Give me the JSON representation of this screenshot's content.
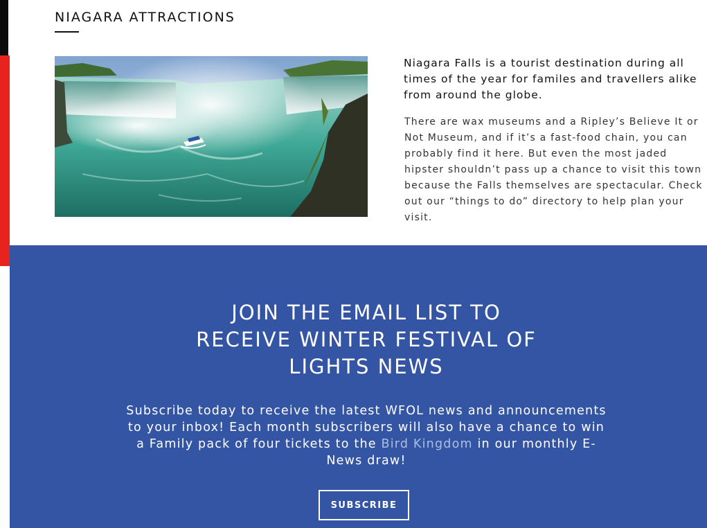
{
  "attractions": {
    "title": "NIAGARA ATTRACTIONS",
    "image_subject": "horseshoe-falls-with-tour-boat-photo",
    "intro": [
      "Niagara Falls is a tourist destination during all",
      "times of the year for familes and travellers alike",
      "from around the globe."
    ],
    "body": [
      "There are wax museums and a Ripley’s Believe It or",
      "Not Museum, and if it’s a fast-food chain, you can",
      "probably find it here. But even the most jaded",
      "hipster shouldn’t pass up a chance to visit this town",
      "because the Falls themselves are spectacular. Check",
      "out our “things to do” directory to help plan your",
      "visit."
    ]
  },
  "signup": {
    "heading": [
      "JOIN THE EMAIL LIST TO",
      "RECEIVE WINTER FESTIVAL OF",
      "LIGHTS NEWS"
    ],
    "body": {
      "line1": "Subscribe today to receive the latest WFOL news and announcements",
      "line2": "to your inbox! Each month subscribers will also have a chance to win",
      "line3_before": "a Family pack of four tickets to the ",
      "link_text": "Bird Kingdom",
      "line3_after": " in our monthly E-",
      "line4": "News draw!"
    },
    "button_label": "SUBSCRIBE"
  },
  "colors": {
    "signup_background": "#3455a3",
    "link": "#aebde2",
    "accent_red": "#e8231e",
    "accent_black": "#0b0b0b"
  }
}
